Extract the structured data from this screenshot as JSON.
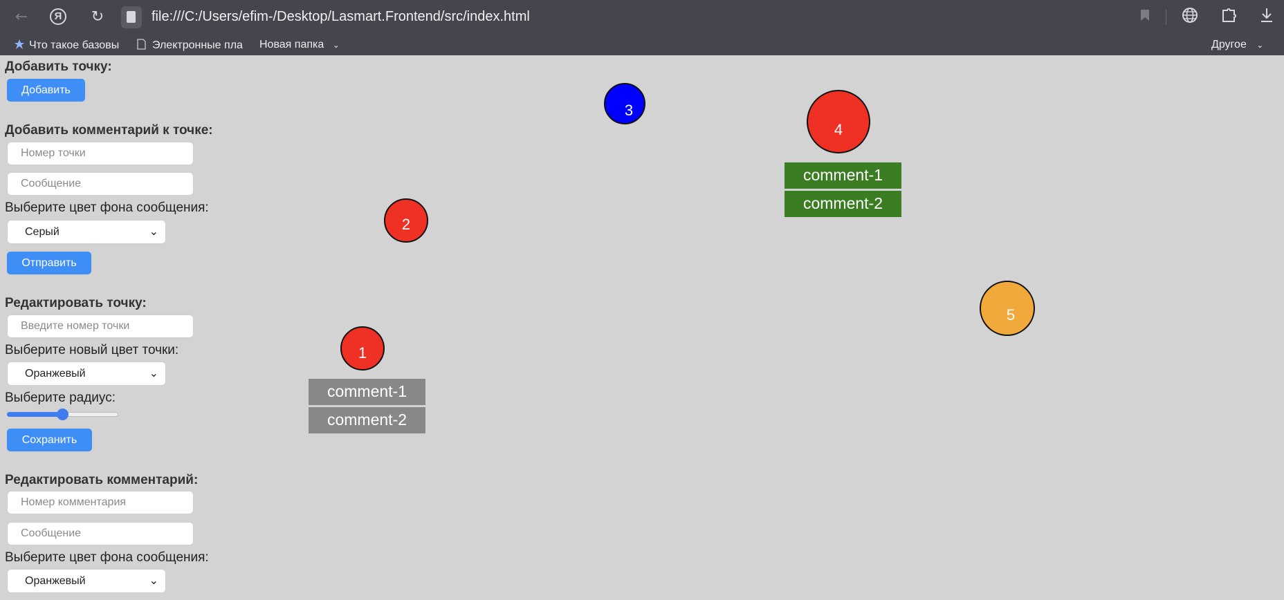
{
  "browser": {
    "url": "file:///C:/Users/efim-/Desktop/Lasmart.Frontend/src/index.html",
    "icons": [
      "back-arrow-icon",
      "yandex-icon",
      "reload-icon",
      "page-icon",
      "bookmark-icon",
      "globe-icon",
      "extension-icon",
      "download-icon"
    ],
    "ya_letter": "Я",
    "bookmarks": [
      {
        "label": "Что такое базовы",
        "icon": "star-icon"
      },
      {
        "label": "Электронные пла",
        "icon": "page-icon"
      },
      {
        "label": "Новая папка",
        "icon": "chevron-down-icon"
      }
    ],
    "other_bookmarks": "Другое"
  },
  "add_point": {
    "heading": "Добавить точку:",
    "button": "Добавить"
  },
  "add_comment": {
    "heading": "Добавить комментарий к точке:",
    "point_placeholder": "Номер точки",
    "message_placeholder": "Сообщение",
    "color_label": "Выберите цвет фона сообщения:",
    "color_value": "Серый",
    "button": "Отправить"
  },
  "edit_point": {
    "heading": "Редактировать точку:",
    "point_placeholder": "Введите номер точки",
    "color_label": "Выберите новый цвет точки:",
    "color_value": "Оранжевый",
    "radius_label": "Выберите радиус:",
    "radius_fraction": 0.5,
    "button": "Сохранить"
  },
  "edit_comment": {
    "heading": "Редактировать комментарий:",
    "comment_placeholder": "Номер комментария",
    "message_placeholder": "Сообщение",
    "color_label": "Выберите цвет фона сообщения:",
    "color_value": "Оранжевый"
  },
  "canvas": {
    "points": [
      {
        "label": "1",
        "color": "#ee3124"
      },
      {
        "label": "2",
        "color": "#ee3124"
      },
      {
        "label": "3",
        "color": "#0000ff"
      },
      {
        "label": "4",
        "color": "#ee3124"
      },
      {
        "label": "5",
        "color": "#f2a93b"
      }
    ],
    "point1_comments": [
      {
        "text": "comment-1",
        "color": "#888888"
      },
      {
        "text": "comment-2",
        "color": "#888888"
      }
    ],
    "point4_comments": [
      {
        "text": "comment-1",
        "color": "#3a7d22"
      },
      {
        "text": "comment-2",
        "color": "#3a7d22"
      }
    ]
  }
}
